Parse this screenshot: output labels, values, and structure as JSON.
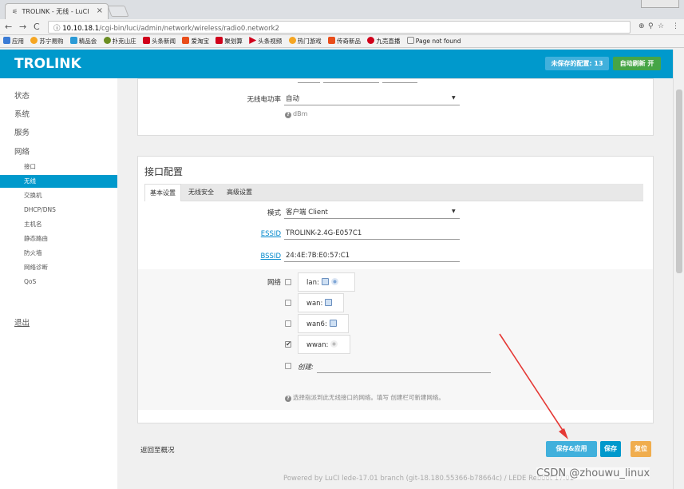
{
  "browser": {
    "tab_title": "TROLINK - 无线 - LuCI",
    "url_host": "10.10.18.1",
    "url_path": "/cgi-bin/luci/admin/network/wireless/radio0.network2",
    "bookmarks": [
      "应用",
      "苏宁易购",
      "精品会",
      "扑克山庄",
      "头条新闻",
      "爱淘宝",
      "聚划算",
      "头条视频",
      "热门游戏",
      "传奇新品",
      "九売直播",
      "Page not found"
    ]
  },
  "header": {
    "brand": "TROLINK",
    "unsaved_label": "未保存的配置: 13",
    "autorefresh_label": "自动刷新 开"
  },
  "sidebar": {
    "status": "状态",
    "system": "系统",
    "services": "服务",
    "network": "网络",
    "sub": [
      "接口",
      "无线",
      "交换机",
      "DHCP/DNS",
      "主机名",
      "静态路由",
      "防火墙",
      "网络诊断",
      "QoS"
    ],
    "logout": "退出"
  },
  "device_section": {
    "tx_power_label": "无线电功率",
    "tx_power_value": "自动",
    "tx_power_hint": "dBm"
  },
  "iface_section": {
    "title": "接口配置",
    "tabs": [
      "基本设置",
      "无线安全",
      "高级设置"
    ],
    "mode_label": "模式",
    "mode_value": "客户端 Client",
    "essid_label": "ESSID",
    "essid_value": "TROLINK-2.4G-E057C1",
    "bssid_label": "BSSID",
    "bssid_value": "24:4E:7B:E0:57:C1",
    "network_label": "网络",
    "networks": [
      {
        "name": "lan:",
        "checked": false
      },
      {
        "name": "wan:",
        "checked": false
      },
      {
        "name": "wan6:",
        "checked": false
      },
      {
        "name": "wwan:",
        "checked": true
      }
    ],
    "create_label": "创建:",
    "network_hint": "选择指派到此无线接口的网络。填写 创建栏可新建网络。"
  },
  "actions": {
    "back": "返回至概况",
    "save_apply": "保存&应用",
    "save": "保存",
    "reset": "复位"
  },
  "footer": "Powered by LuCI lede-17.01 branch (git-18.180.55366-b78664c) / LEDE Reboot 17.01",
  "watermark": "CSDN @zhouwu_linux",
  "colors": {
    "header": "#0099cc",
    "save_apply": "#41b0dc",
    "save": "#0099cc",
    "reset": "#f0ad4e",
    "autorefresh": "#46a546"
  }
}
